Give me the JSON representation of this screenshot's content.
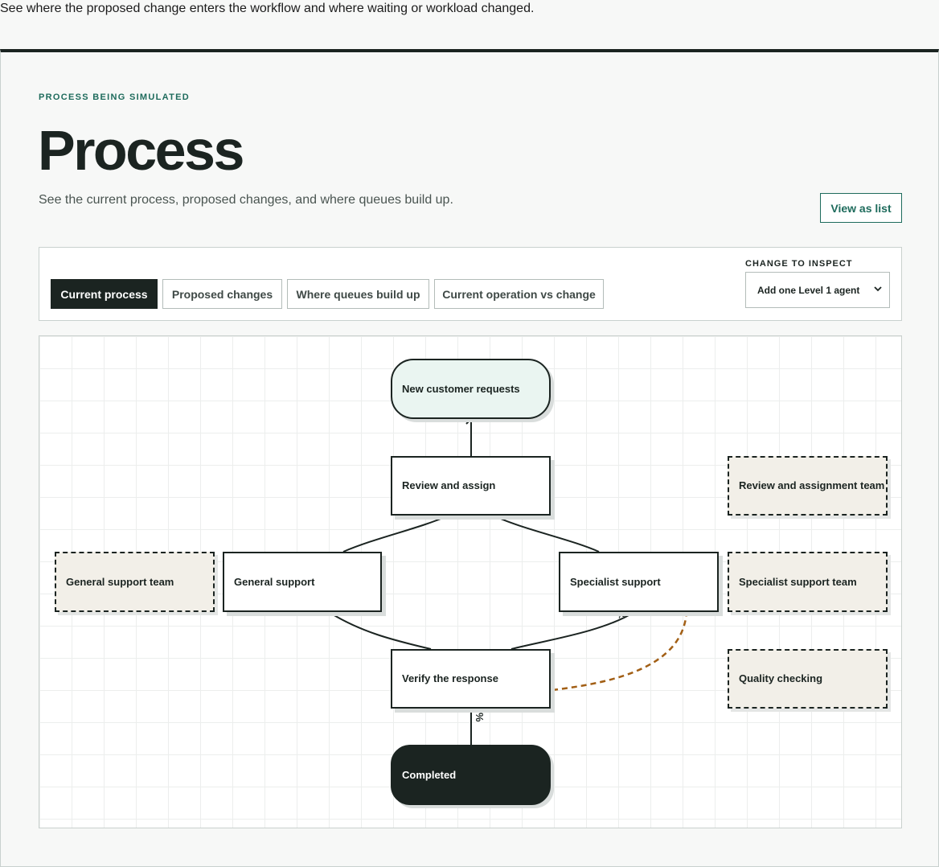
{
  "caption": "See where the proposed change enters the workflow and where waiting or workload changed.",
  "header": {
    "eyebrow": "PROCESS BEING SIMULATED",
    "title": "Process",
    "subtitle": "See the current process, proposed changes, and where queues build up.",
    "view_list_label": "View as list"
  },
  "tabs": [
    {
      "label": "Current process",
      "active": true
    },
    {
      "label": "Proposed changes",
      "active": false
    },
    {
      "label": "Where queues build up",
      "active": false
    },
    {
      "label": "Current operation vs change",
      "active": false
    }
  ],
  "change_selector": {
    "label": "CHANGE TO INSPECT",
    "selected": "Add one Level 1 agent"
  },
  "diagram": {
    "nodes": {
      "start": "New customer requests",
      "review": "Review and assign",
      "general": "General support",
      "specialist": "Specialist support",
      "verify": "Verify the response",
      "completed": "Completed"
    },
    "lanes": {
      "review_team": "Review and assignment team",
      "general_team": "General support team",
      "specialist_team": "Specialist support team",
      "quality": "Quality checking"
    },
    "edge_markers": {
      "specialist_verify": "%",
      "verify_completed": "%"
    },
    "colors": {
      "ink": "#1b2421",
      "accent": "#1e6b5c",
      "start_fill": "#eaf5f1",
      "lane_fill": "#f2efe8",
      "rework_edge": "#a25f15"
    }
  }
}
